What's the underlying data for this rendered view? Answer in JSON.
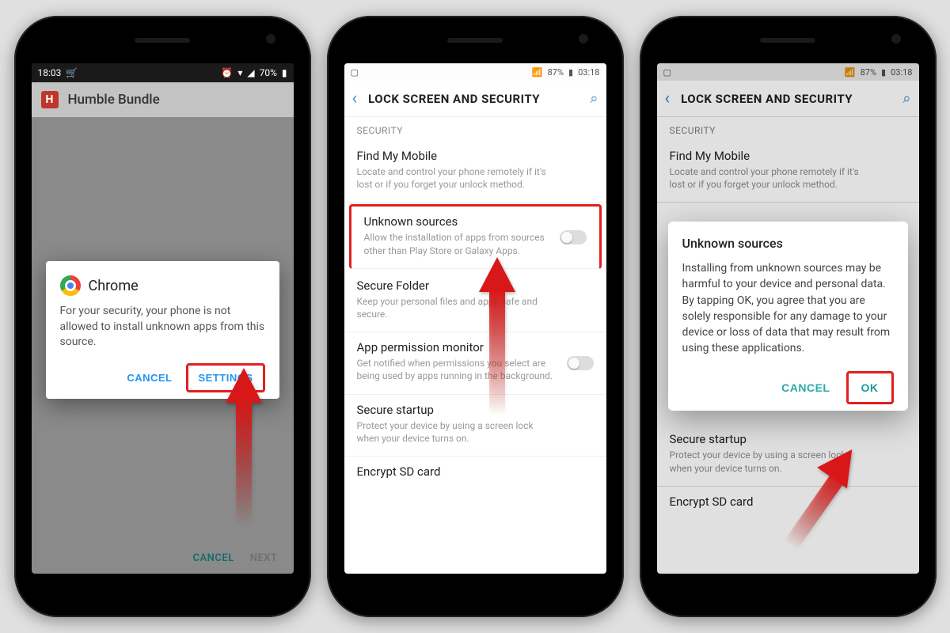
{
  "colors": {
    "accent": "#2196f3",
    "teal": "#1f9a9a",
    "highlight": "#e02020"
  },
  "phone1": {
    "statusbar": {
      "time": "18:03",
      "battery": "70%"
    },
    "app_title": "Humble Bundle",
    "dialog": {
      "title": "Chrome",
      "body": "For your security, your phone is not allowed to install unknown apps from this source.",
      "cancel": "CANCEL",
      "settings": "SETTINGS"
    },
    "bottom": {
      "cancel": "CANCEL",
      "next": "NEXT"
    }
  },
  "phone2": {
    "statusbar": {
      "battery": "87%",
      "time": "03:18"
    },
    "title": "LOCK SCREEN AND SECURITY",
    "section": "SECURITY",
    "items": [
      {
        "title": "Find My Mobile",
        "desc": "Locate and control your phone remotely if it's lost or if you forget your unlock method."
      },
      {
        "title": "Unknown sources",
        "desc": "Allow the installation of apps from sources other than Play Store or Galaxy Apps.",
        "toggle": true,
        "highlight": true
      },
      {
        "title": "Secure Folder",
        "desc": "Keep your personal files and apps safe and secure."
      },
      {
        "title": "App permission monitor",
        "desc": "Get notified when permissions you select are being used by apps running in the background.",
        "toggle": true
      },
      {
        "title": "Secure startup",
        "desc": "Protect your device by using a screen lock when your device turns on."
      },
      {
        "title": "Encrypt SD card",
        "desc": ""
      }
    ]
  },
  "phone3": {
    "statusbar": {
      "battery": "87%",
      "time": "03:18"
    },
    "title": "LOCK SCREEN AND SECURITY",
    "section": "SECURITY",
    "items": [
      {
        "title": "Find My Mobile",
        "desc": "Locate and control your phone remotely if it's lost or if you forget your unlock method."
      },
      {
        "title": "Secure startup",
        "desc": "Protect your device by using a screen lock when your device turns on."
      },
      {
        "title": "Encrypt SD card",
        "desc": ""
      }
    ],
    "dialog": {
      "title": "Unknown sources",
      "body": "Installing from unknown sources may be harmful to your device and personal data. By tapping OK, you agree that you are solely responsible for any damage to your device or loss of data that may result from using these applications.",
      "cancel": "CANCEL",
      "ok": "OK"
    }
  }
}
